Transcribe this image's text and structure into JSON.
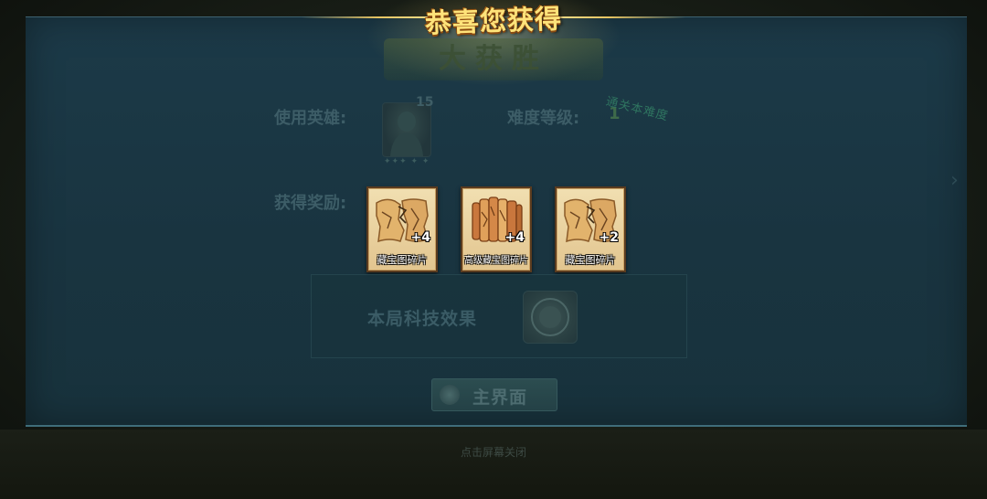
{
  "dialog": {
    "banner_title": "恭喜您获得",
    "header_faded": "大获胜",
    "close_hint": "点击屏幕关闭"
  },
  "hero": {
    "label": "使用英雄:",
    "level": "15",
    "stars": "✦✦✦ ✦ ✦"
  },
  "difficulty": {
    "label": "难度等级:",
    "value": "1",
    "badge": "通关本难度"
  },
  "rewards": {
    "label": "获得奖励:",
    "items": [
      {
        "name": "藏宝图碎片",
        "qty": "+4",
        "icon": "treasure-map-fragment-icon"
      },
      {
        "name": "高级藏宝图碎片",
        "qty": "+4",
        "icon": "advanced-treasure-map-fragment-icon"
      },
      {
        "name": "藏宝图碎片",
        "qty": "+2",
        "icon": "treasure-map-fragment-icon"
      }
    ]
  },
  "tech": {
    "label": "本局科技效果",
    "icon": "tech-emblem-icon"
  },
  "main_button": {
    "label": "主界面",
    "icon": "home-icon"
  },
  "colors": {
    "panel": "#1c3a48",
    "title_gold": "#ffe37a",
    "card_border": "#5a3b1f"
  }
}
